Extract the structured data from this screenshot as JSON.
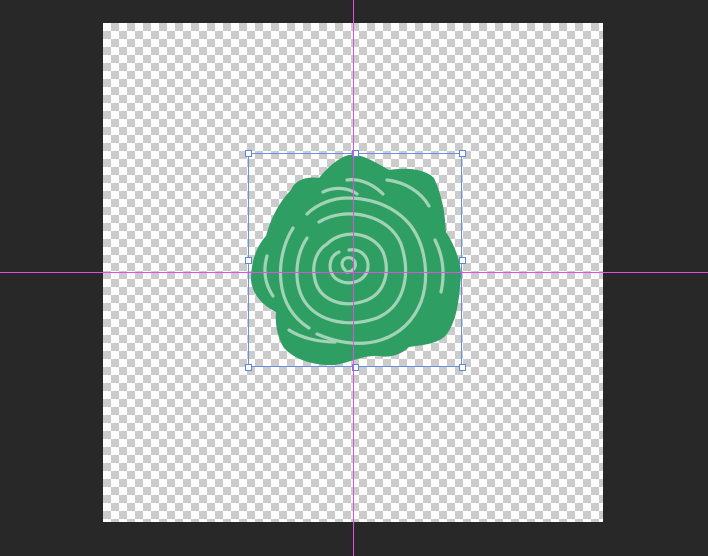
{
  "document": {
    "canvas_background": "transparent-checkerboard",
    "workspace_color": "#282828"
  },
  "layer": {
    "name": "rose",
    "icon": "rose-icon",
    "fill_color": "#2f9e62",
    "line_color": "#a9d6bb"
  },
  "transform": {
    "border_color": "#6b8fe0",
    "handles": [
      "top-left",
      "top-center",
      "top-right",
      "middle-left",
      "middle-right",
      "bottom-left",
      "bottom-center",
      "bottom-right"
    ]
  },
  "guides": {
    "color": "#e64ce6",
    "orientations": [
      "vertical",
      "horizontal"
    ]
  }
}
